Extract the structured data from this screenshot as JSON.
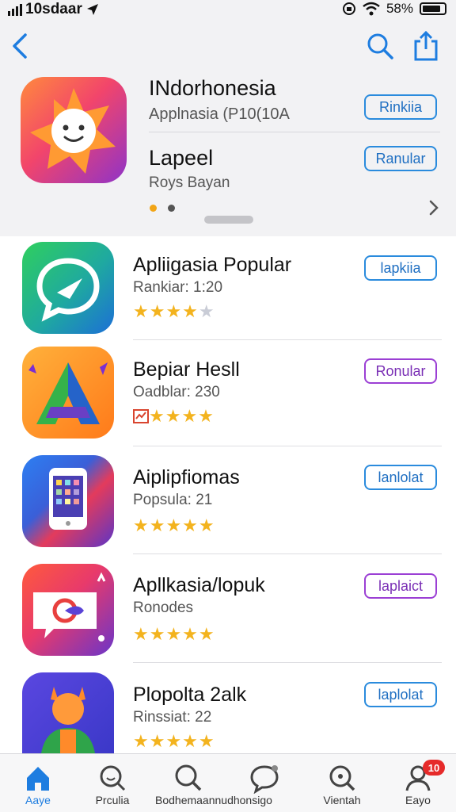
{
  "status_bar": {
    "time": "10sdaar",
    "battery": "58%"
  },
  "featured": {
    "title": "INdorhonesia",
    "subtitle": "Applnasia (P10(10A",
    "button_1": "Rinkiia",
    "title_2": "Lapeel",
    "subtitle_2": "Roys Bayan",
    "button_2": "Ranular"
  },
  "apps": [
    {
      "title": "Apliigasia Popular",
      "subtitle": "Rankiar: 1:20",
      "button": "lapkiia",
      "stars": "★★★★",
      "star_off": "★",
      "button_color": "blue"
    },
    {
      "title": "Bepiar Hesll",
      "subtitle": "Oadblar: 230",
      "button": "Ronular",
      "stars": "★★★★",
      "star_off": "",
      "button_color": "purple"
    },
    {
      "title": "Aiplipfiomas",
      "subtitle": "Popsula: 21",
      "button": "lanlolat",
      "stars": "★★★★★",
      "star_off": "",
      "button_color": "blue"
    },
    {
      "title": "Apllkasia/lopuk",
      "subtitle": "Ronodes",
      "button": "laplaict",
      "stars": "★★★★★",
      "star_off": "",
      "button_color": "purple"
    },
    {
      "title": "Plopolta 2alk",
      "subtitle": "Rinssiat: 22",
      "button": "laplolat",
      "stars": "★★★★★",
      "star_off": "",
      "button_color": "blue"
    }
  ],
  "tabs": [
    {
      "label": "Aaye",
      "icon": "home-icon"
    },
    {
      "label": "Prculia",
      "icon": "search-smile-icon"
    },
    {
      "label": "Bodhemaannudhonsigo",
      "icon": "search-icon"
    },
    {
      "label": "",
      "icon": "chat-icon"
    },
    {
      "label": "Vientah",
      "icon": "magnifier-icon"
    },
    {
      "label": "Eayo",
      "icon": "profile-icon"
    }
  ],
  "badge_count": "10",
  "colors": {
    "accent": "#1e7de0",
    "star": "#f3b31e",
    "purple": "#9b3fd4"
  }
}
